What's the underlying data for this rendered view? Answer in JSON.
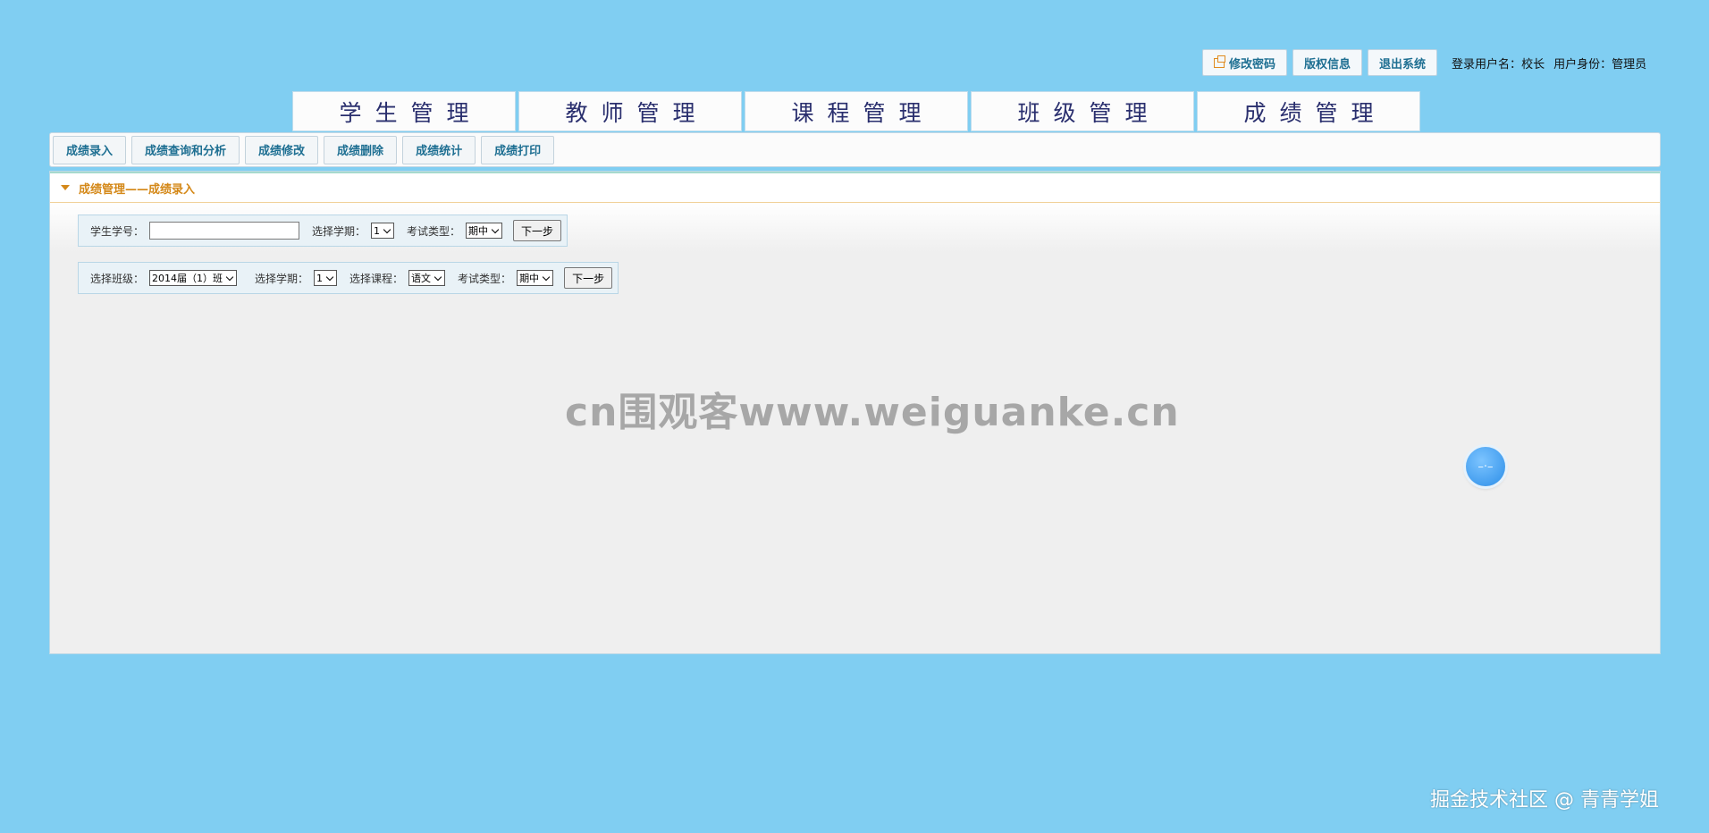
{
  "topbar": {
    "buttons": [
      "修改密码",
      "版权信息",
      "退出系统"
    ],
    "user_label": "登录用户名：",
    "user_name": "校长",
    "role_label": "用户身份：",
    "role_value": "管理员"
  },
  "nav": {
    "tabs": [
      "学生管理",
      "教师管理",
      "课程管理",
      "班级管理",
      "成绩管理"
    ]
  },
  "subnav": {
    "items": [
      "成绩录入",
      "成绩查询和分析",
      "成绩修改",
      "成绩删除",
      "成绩统计",
      "成绩打印"
    ]
  },
  "panel": {
    "title": "成绩管理——成绩录入"
  },
  "form1": {
    "student_id_label": "学生学号：",
    "student_id_value": "",
    "term_label": "选择学期：",
    "term_value": "1",
    "exam_label": "考试类型：",
    "exam_value": "期中",
    "next_label": "下一步"
  },
  "form2": {
    "class_label": "选择班级：",
    "class_value": "2014届（1）班",
    "term_label": "选择学期：",
    "term_value": "1",
    "course_label": "选择课程：",
    "course_value": "语文",
    "exam_label": "考试类型：",
    "exam_value": "期中",
    "next_label": "下一步"
  },
  "watermark": "cn围观客www.weiguanke.cn",
  "credit": "掘金技术社区 @ 青青学姐"
}
